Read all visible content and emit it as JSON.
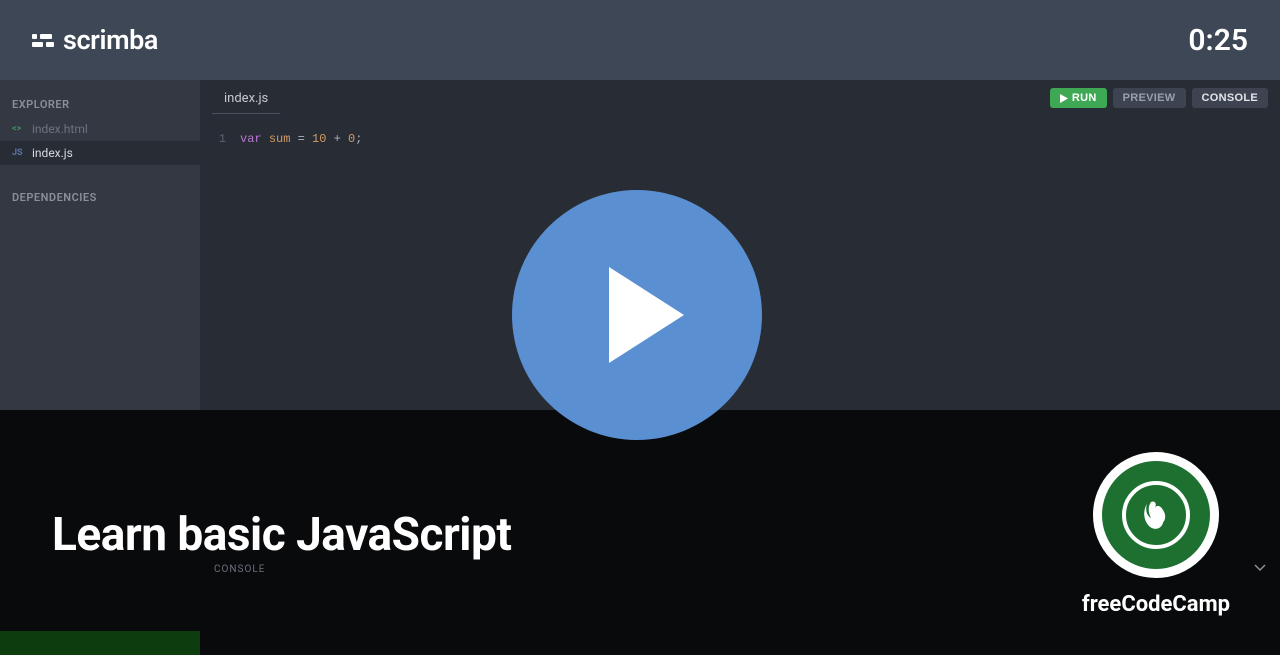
{
  "header": {
    "brand": "scrimba",
    "timer": "0:25"
  },
  "sidebar": {
    "explorer_label": "EXPLORER",
    "dependencies_label": "DEPENDENCIES",
    "files": [
      {
        "name": "index.html",
        "icon": "<>",
        "kind": "html",
        "active": false
      },
      {
        "name": "index.js",
        "icon": "JS",
        "kind": "js",
        "active": true
      }
    ]
  },
  "editor": {
    "tab": "index.js",
    "buttons": {
      "run": "RUN",
      "preview": "PREVIEW",
      "console": "CONSOLE"
    },
    "code": {
      "line_number": "1",
      "tokens": {
        "keyword": "var",
        "varname": "sum",
        "eq": "=",
        "num1": "10",
        "plus": "+",
        "num2": "0",
        "semi": ";"
      }
    }
  },
  "console_panel": {
    "label": "CONSOLE"
  },
  "lesson": {
    "title": "Learn basic JavaScript",
    "author": "freeCodeCamp"
  },
  "colors": {
    "accent_green": "#3fa855",
    "brand_blue": "#5a8fd1",
    "fcc_green": "#1e7030"
  }
}
